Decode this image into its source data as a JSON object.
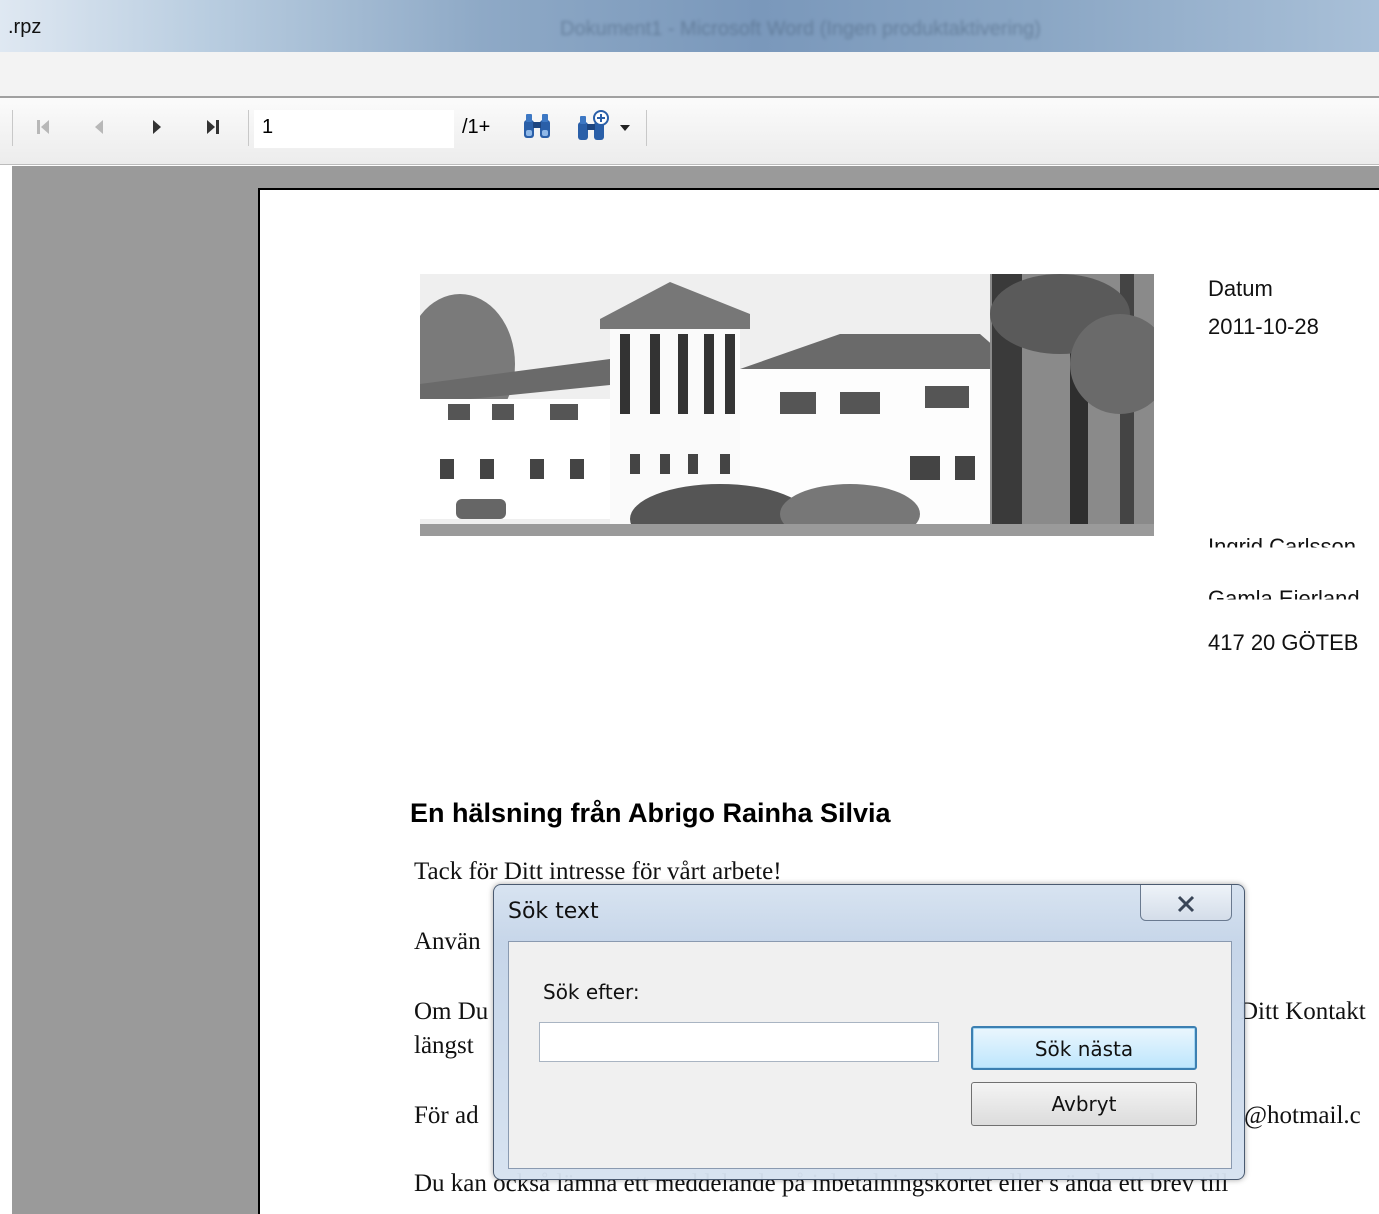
{
  "window": {
    "title": ".rpz",
    "ghost_title": "Dokument1 - Microsoft Word (Ingen produktaktivering)"
  },
  "toolbar": {
    "page_value": "1",
    "page_total": "/1+",
    "icons": [
      "first-page-icon",
      "previous-page-icon",
      "next-page-icon",
      "last-page-icon",
      "find-binoculars-icon",
      "find-more-icon"
    ]
  },
  "document": {
    "datum_label": "Datum",
    "datum_value": "2011-10-28",
    "recipient_name": "Ingrid Carlsson",
    "recipient_street": "Gamla Ejerland",
    "recipient_city": "417 20 GÖTEB",
    "heading": "En hälsning från Abrigo Rainha Silvia",
    "line1": "Tack för Ditt intresse för vårt arbete!",
    "line2_start": "Använ",
    "line3_start": "Om Du",
    "line3_end": "Ditt Kontakt",
    "line4_start": "längst",
    "line5_start": "För ad",
    "line5_end": "@hotmail.c",
    "line6": "Du kan också lämna ett meddelande på inbetalningskortet eller s ända ett brev till"
  },
  "dialog": {
    "title": "Sök text",
    "label": "Sök efter:",
    "input_value": "",
    "find_next_label": "Sök nästa",
    "cancel_label": "Avbryt"
  }
}
